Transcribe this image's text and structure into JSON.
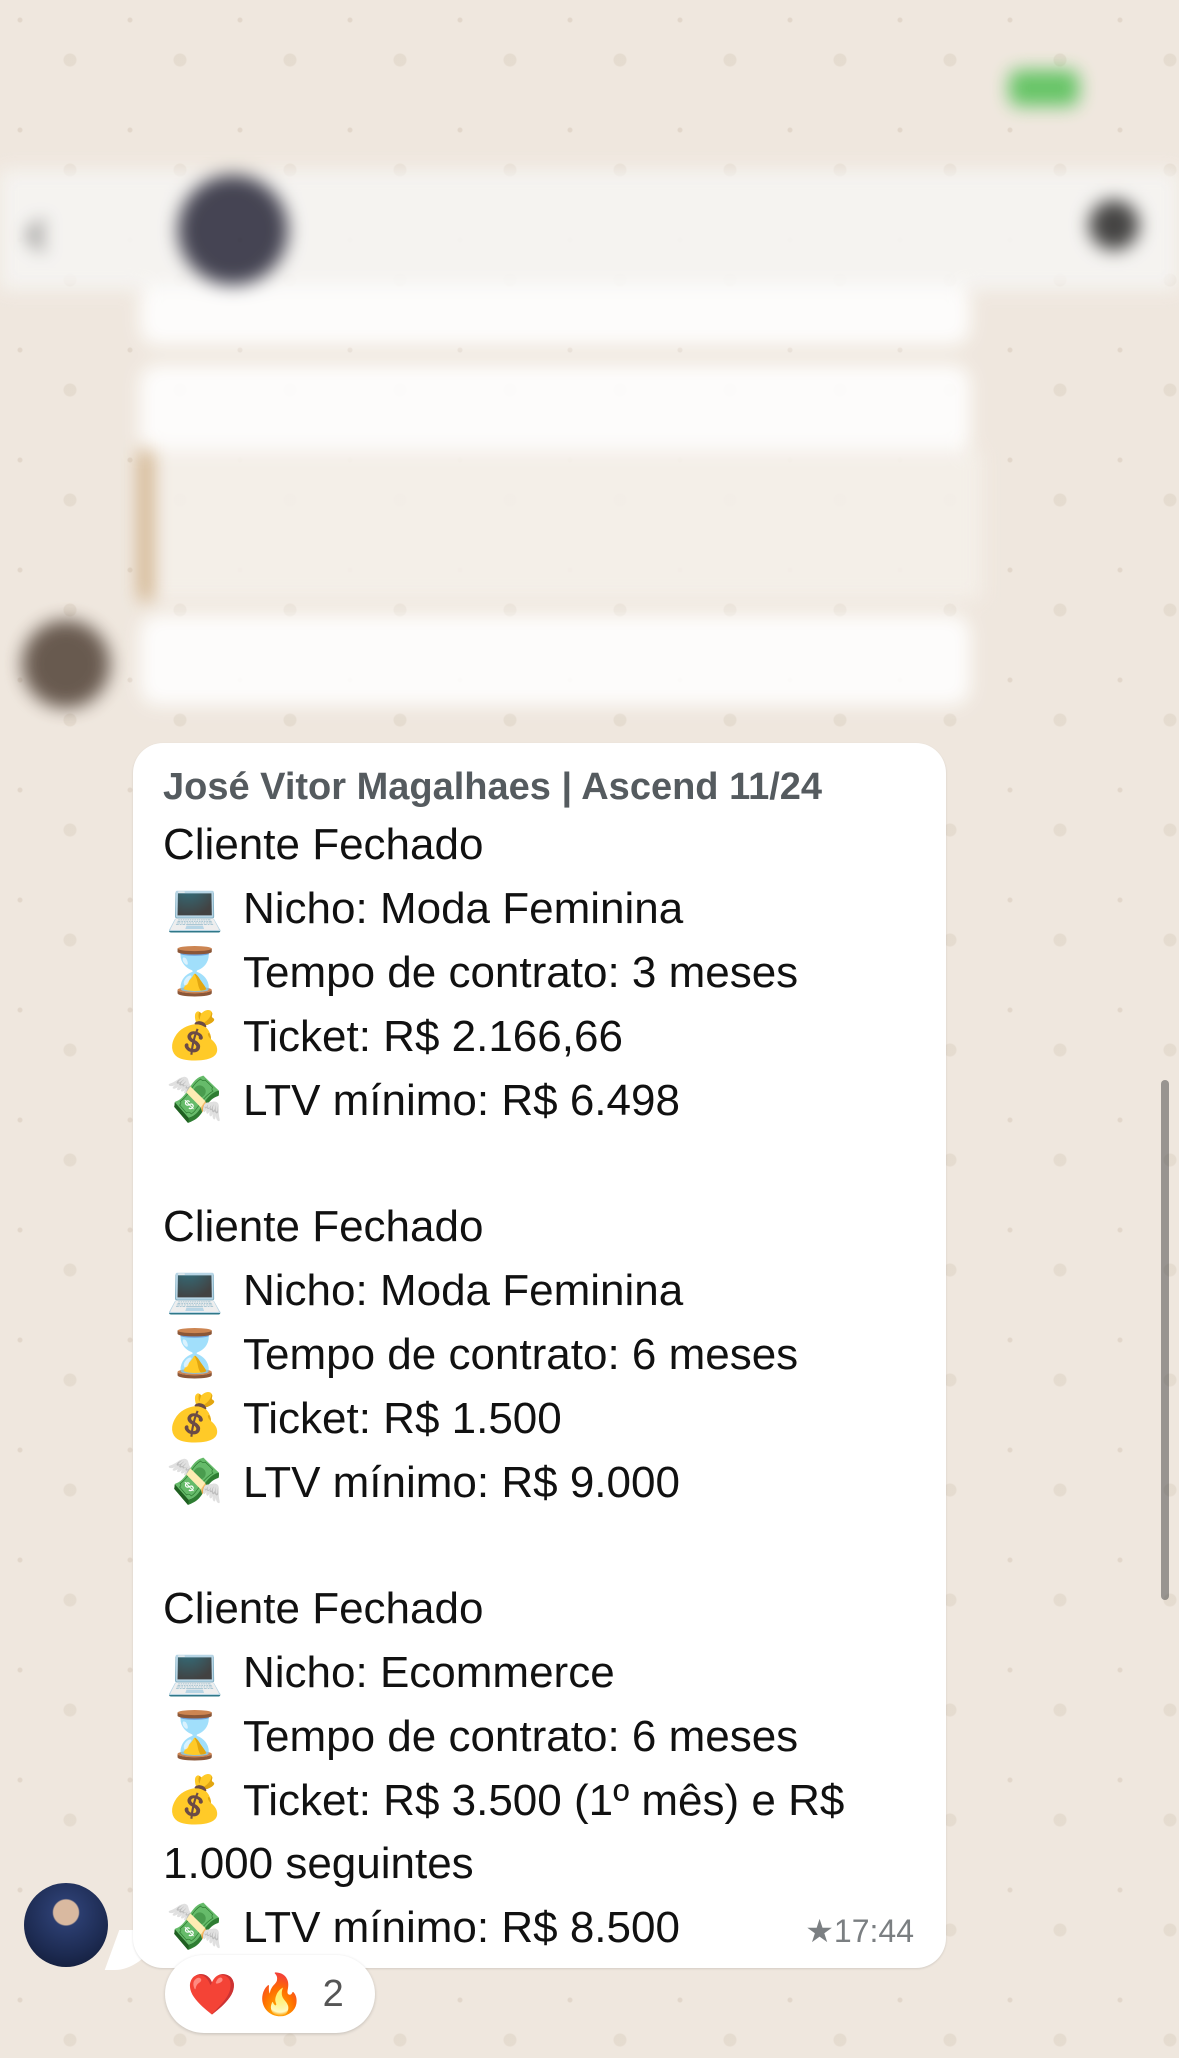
{
  "message": {
    "sender": "José Vitor Magalhaes | Ascend 11/24",
    "timestamp": "★17:44",
    "lines": [
      {
        "emoji": "",
        "text": "Cliente Fechado"
      },
      {
        "emoji": "💻",
        "text": "Nicho: Moda Feminina"
      },
      {
        "emoji": "⌛",
        "text": "Tempo de contrato: 3 meses"
      },
      {
        "emoji": "💰",
        "text": "Ticket: R$ 2.166,66"
      },
      {
        "emoji": "💸",
        "text": "LTV mínimo: R$ 6.498"
      },
      {
        "emoji": "",
        "text": ""
      },
      {
        "emoji": "",
        "text": "Cliente Fechado"
      },
      {
        "emoji": "💻",
        "text": "Nicho: Moda Feminina"
      },
      {
        "emoji": "⌛",
        "text": "Tempo de contrato: 6 meses"
      },
      {
        "emoji": "💰",
        "text": "Ticket: R$ 1.500"
      },
      {
        "emoji": "💸",
        "text": "LTV mínimo: R$ 9.000"
      },
      {
        "emoji": "",
        "text": ""
      },
      {
        "emoji": "",
        "text": "Cliente Fechado"
      },
      {
        "emoji": "💻",
        "text": "Nicho: Ecommerce"
      },
      {
        "emoji": "⌛",
        "text": "Tempo de contrato: 6 meses"
      },
      {
        "emoji": "💰",
        "text": "Ticket: R$ 3.500 (1º mês) e R$"
      },
      {
        "emoji": "",
        "text": "1.000 seguintes"
      },
      {
        "emoji": "💸",
        "text": "LTV mínimo: R$ 8.500"
      }
    ]
  },
  "reactions": {
    "heart": "❤️",
    "fire": "🔥",
    "count": "2"
  },
  "blurred_header": {
    "back_icon": "‹",
    "more_icon": "more-icon"
  }
}
